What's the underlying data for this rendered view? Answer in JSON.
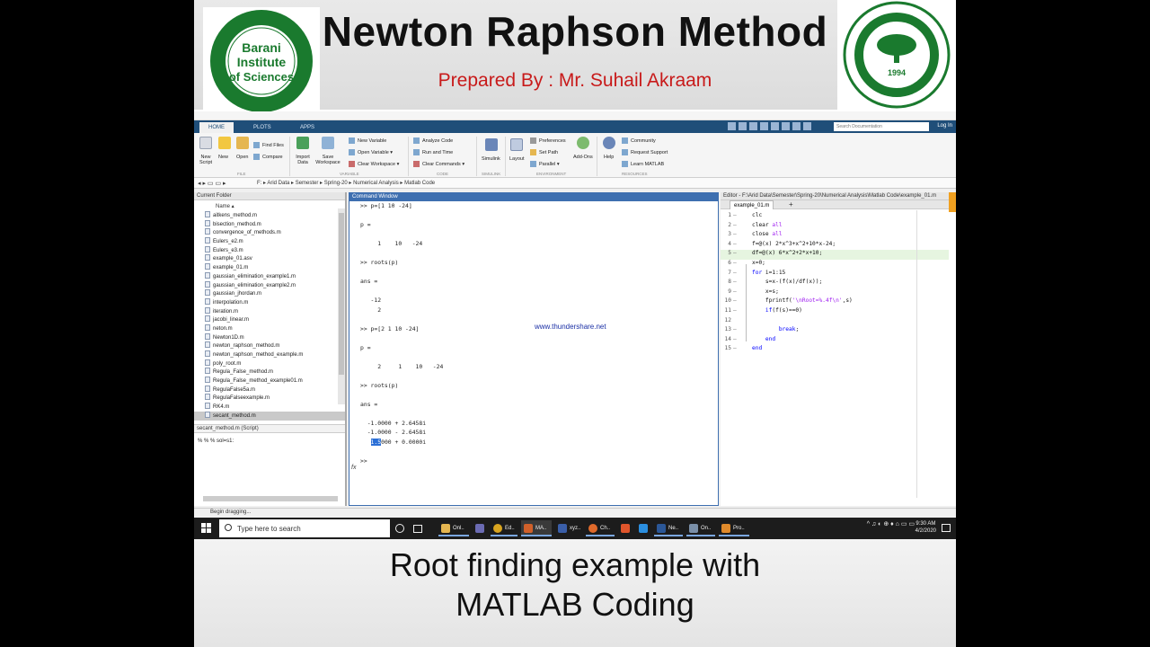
{
  "banner": {
    "title": "Newton Raphson Method",
    "subtitle": "Prepared By : Mr. Suhail Akraam",
    "left_logo": {
      "line1": "Barani",
      "line2": "Institute",
      "line3": "of Sciences",
      "ring_text": "BUREWALA JOINT VENTURE · PMAS ARID AGRICULTURE UNIVERSITY RWP"
    },
    "right_logo": {
      "ring_text": "PIR MEHR ALI SHAH ARID AGRICULTURE UNIVERSITY · RAWALPINDI",
      "year": "1994"
    }
  },
  "toolstrip": {
    "tabs": [
      "HOME",
      "PLOTS",
      "APPS"
    ],
    "search_placeholder": "Search Documentation",
    "login": "Log In"
  },
  "ribbon": {
    "new_script": "New Script",
    "new": "New",
    "open": "Open",
    "find_files": "Find Files",
    "compare": "Compare",
    "import_data": "Import Data",
    "save_workspace": "Save Workspace",
    "new_variable": "New Variable",
    "open_variable": "Open Variable",
    "clear_workspace": "Clear Workspace",
    "analyze_code": "Analyze Code",
    "run_and_time": "Run and Time",
    "clear_commands": "Clear Commands",
    "simulink": "Simulink",
    "layout": "Layout",
    "preferences": "Preferences",
    "set_path": "Set Path",
    "parallel": "Parallel",
    "add_ons": "Add-Ons",
    "help": "Help",
    "community": "Community",
    "request_support": "Request Support",
    "learn_matlab": "Learn MATLAB",
    "sections": [
      "FILE",
      "VARIABLE",
      "CODE",
      "SIMULINK",
      "ENVIRONMENT",
      "RESOURCES"
    ]
  },
  "address": "F: ▸ Arid Data ▸ Semester ▸ Spring-20 ▸ Numerical Analysis ▸ Matlab Code",
  "current_folder": {
    "title": "Current Folder",
    "column": "Name ▴",
    "files": [
      "aitkens_method.m",
      "bisection_method.m",
      "convergence_of_methods.m",
      "Eulers_e2.m",
      "Eulers_e3.m",
      "example_01.asv",
      "example_01.m",
      "gaussian_elimination_example1.m",
      "gaussian_elimination_example2.m",
      "gaussian_jhordan.m",
      "interpolation.m",
      "iteration.m",
      "jacobi_linear.m",
      "neton.m",
      "Newton1D.m",
      "newton_raphson_method.m",
      "newton_raphson_method_example.m",
      "poly_root.m",
      "Regula_False_method.m",
      "Regula_False_method_example01.m",
      "RegulaFalse5a.m",
      "RegulaFalseexample.m",
      "RK4.m",
      "secant_method.m"
    ],
    "selected_index": 23,
    "details_title": "secant_method.m  (Script)",
    "details_text": "% % % sol=s1:"
  },
  "command_window": {
    "title": "Command Window",
    "lines": [
      ">> p=[1 10 -24]",
      "",
      "p =",
      "",
      "     1    10   -24",
      "",
      ">> roots(p)",
      "",
      "ans =",
      "",
      "   -12",
      "     2",
      "",
      ">> p=[2 1 10 -24]",
      "",
      "p =",
      "",
      "     2     1    10   -24",
      "",
      ">> roots(p)",
      "",
      "ans =",
      "",
      "  -1.0000 + 2.6458i",
      "  -1.0000 - 2.6458i",
      "   1.5000 + 0.0000i",
      "",
      ">> "
    ],
    "highlight_text": "1.5",
    "fx_label": "fx",
    "watermark": "www.thundershare.net"
  },
  "editor": {
    "title": "Editor - F:\\Arid Data\\Semester\\Spring-20\\Numerical Analysis\\Matlab Code\\example_01.m",
    "tab": "example_01.m",
    "plus": "+",
    "side_badge": "Editor",
    "lines": [
      {
        "n": "1",
        "code": "clc"
      },
      {
        "n": "2",
        "code": "clear all"
      },
      {
        "n": "3",
        "code": "close all"
      },
      {
        "n": "4",
        "code": "f=@(x) 2*x^3+x^2+10*x-24;"
      },
      {
        "n": "5",
        "code": "df=@(x) 6*x^2+2*x+10;"
      },
      {
        "n": "6",
        "code": "x=0;"
      },
      {
        "n": "7",
        "code": "for i=1:15"
      },
      {
        "n": "8",
        "code": "    s=x-(f(x)/df(x));"
      },
      {
        "n": "9",
        "code": "    x=s;"
      },
      {
        "n": "10",
        "code": "    fprintf('\\nRoot=%.4f\\n',s)"
      },
      {
        "n": "11",
        "code": "    if(f(s)==0)"
      },
      {
        "n": "12",
        "code": ""
      },
      {
        "n": "13",
        "code": "        break;"
      },
      {
        "n": "14",
        "code": "    end"
      },
      {
        "n": "15",
        "code": "end"
      }
    ]
  },
  "status": "Begin dragging...",
  "taskbar": {
    "search_placeholder": "Type here to search",
    "apps": [
      "Onl..",
      "Ed..",
      "MA..",
      "xyz..",
      "Ch..",
      "Ne..",
      "On..",
      "Pro.."
    ],
    "time": "9:30 AM",
    "date": "4/2/2020"
  },
  "caption": {
    "line1": "Root finding example with",
    "line2": "MATLAB Coding"
  },
  "colors": {
    "toolstrip_blue": "#1f4e79",
    "command_title_blue": "#3e6fb0",
    "subtitle_red": "#c81a1a",
    "logo_green": "#1a7a2e"
  }
}
